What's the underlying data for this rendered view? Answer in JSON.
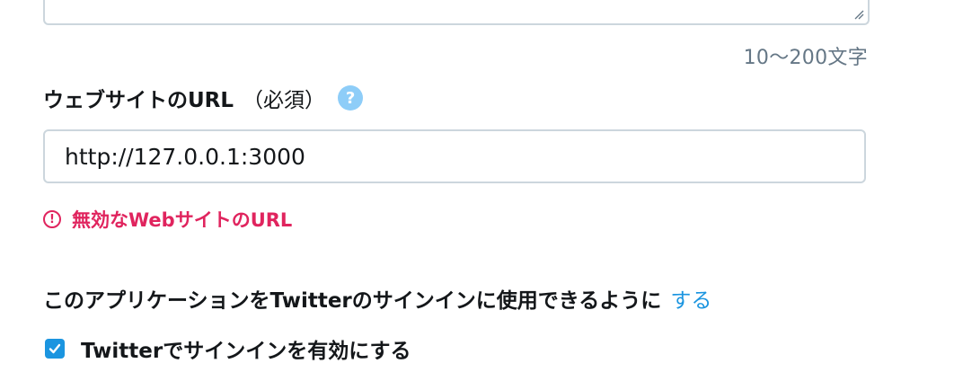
{
  "description_field": {
    "char_count": "10〜200文字"
  },
  "website_field": {
    "label": "ウェブサイトのURL",
    "required": "（必須）",
    "help_icon_glyph": "?",
    "value": "http://127.0.0.1:3000",
    "error_icon_glyph": "!",
    "error": "無効なWebサイトのURL"
  },
  "twitter_signin": {
    "label": "このアプリケーションをTwitterのサインインに使用できるように",
    "link": "する",
    "checkbox_label": "Twitterでサインインを有効にする",
    "checked": true
  },
  "colors": {
    "accent": "#1b95e0",
    "error": "#e0245e",
    "border": "#ccd6dd",
    "help_icon": "#8ecdf8"
  },
  "icons": {
    "help": "question-circle-icon",
    "error": "exclamation-circle-icon",
    "check": "checkmark-icon",
    "resize": "resize-handle-icon"
  }
}
